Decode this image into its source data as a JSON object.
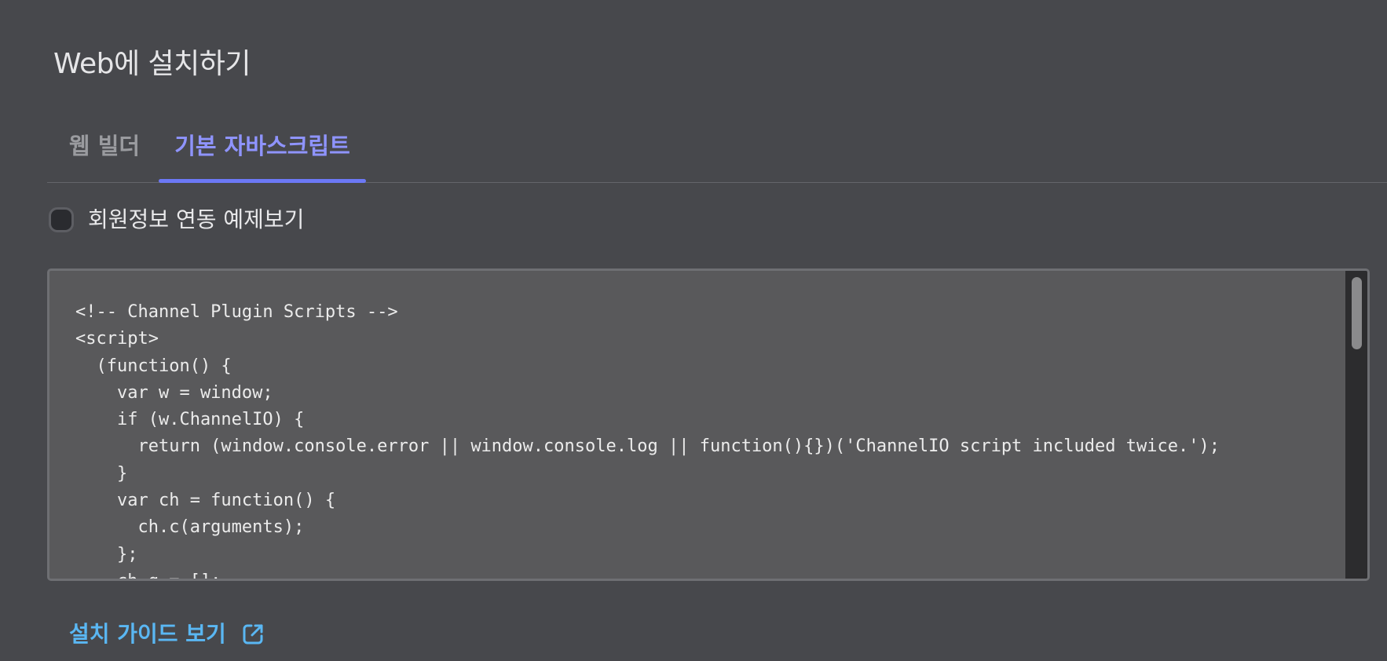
{
  "page": {
    "title": "Web에 설치하기"
  },
  "tabs": [
    {
      "label": "웹 빌더",
      "active": false
    },
    {
      "label": "기본 자바스크립트",
      "active": true
    }
  ],
  "checkbox": {
    "label": "회원정보 연동 예제보기",
    "checked": false
  },
  "code": {
    "text": "<!-- Channel Plugin Scripts -->\n<script>\n  (function() {\n    var w = window;\n    if (w.ChannelIO) {\n      return (window.console.error || window.console.log || function(){})('ChannelIO script included twice.');\n    }\n    var ch = function() {\n      ch.c(arguments);\n    };\n    ch.q = [];"
  },
  "guide": {
    "label": "설치 가이드 보기",
    "icon": "external-link-icon"
  },
  "colors": {
    "background": "#47484c",
    "accent_tab": "#8f94ff",
    "tab_underline": "#6c78f5",
    "link": "#5ab7f3",
    "code_background": "#59595b"
  }
}
